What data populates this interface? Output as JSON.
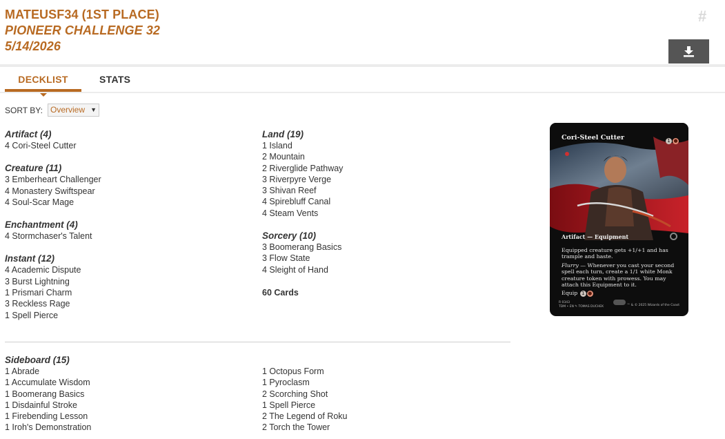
{
  "header": {
    "title_line1": "MATEUSF34 (1ST PLACE)",
    "title_line2": "PIONEER CHALLENGE 32",
    "title_line3": "5/14/2026",
    "hash_symbol": "#",
    "download_icon": "download-icon"
  },
  "tabs": [
    {
      "label": "DECKLIST",
      "active": true
    },
    {
      "label": "STATS",
      "active": false
    }
  ],
  "sort": {
    "label": "SORT BY:",
    "selected": "Overview"
  },
  "decklist": {
    "left_groups": [
      {
        "heading": "Artifact (4)",
        "cards": [
          "4 Cori-Steel Cutter"
        ]
      },
      {
        "heading": "Creature (11)",
        "cards": [
          "3 Emberheart Challenger",
          "4 Monastery Swiftspear",
          "4 Soul-Scar Mage"
        ]
      },
      {
        "heading": "Enchantment (4)",
        "cards": [
          "4 Stormchaser's Talent"
        ]
      },
      {
        "heading": "Instant (12)",
        "cards": [
          "4 Academic Dispute",
          "3 Burst Lightning",
          "1 Prismari Charm",
          "3 Reckless Rage",
          "1 Spell Pierce"
        ]
      }
    ],
    "right_groups": [
      {
        "heading": "Land (19)",
        "cards": [
          "1 Island",
          "2 Mountain",
          "2 Riverglide Pathway",
          "3 Riverpyre Verge",
          "3 Shivan Reef",
          "4 Spirebluff Canal",
          "4 Steam Vents"
        ]
      },
      {
        "heading": "Sorcery (10)",
        "cards": [
          "3 Boomerang Basics",
          "3 Flow State",
          "4 Sleight of Hand"
        ]
      }
    ],
    "total": "60 Cards"
  },
  "sideboard": {
    "heading": "Sideboard (15)",
    "left": [
      "1 Abrade",
      "1 Accumulate Wisdom",
      "1 Boomerang Basics",
      "1 Disdainful Stroke",
      "1 Firebending Lesson",
      "1 Iroh's Demonstration"
    ],
    "right": [
      "1 Octopus Form",
      "1 Pyroclasm",
      "2 Scorching Shot",
      "1 Spell Pierce",
      "2 The Legend of Roku",
      "2 Torch the Tower"
    ]
  },
  "card_preview": {
    "name": "Cori-Steel Cutter",
    "cost": [
      "1",
      "R"
    ],
    "type_line": "Artifact — Equipment",
    "text1": "Equipped creature gets +1/+1 and has trample and haste.",
    "text2_italic": "Flurry",
    "text2": " — Whenever you cast your second spell each turn, create a 1/1 white Monk creature token with prowess. You may attach this Equipment to it.",
    "text3": "Equip",
    "equip_cost": [
      "1",
      "R"
    ],
    "footer_left": "R 0343\nTDM • EN ✎ TOMAS DUCHEK",
    "footer_right": "™ & © 2025 Wizards of the Coast"
  },
  "colors": {
    "accent": "#b86a22",
    "text": "#333333",
    "button": "#555555"
  }
}
